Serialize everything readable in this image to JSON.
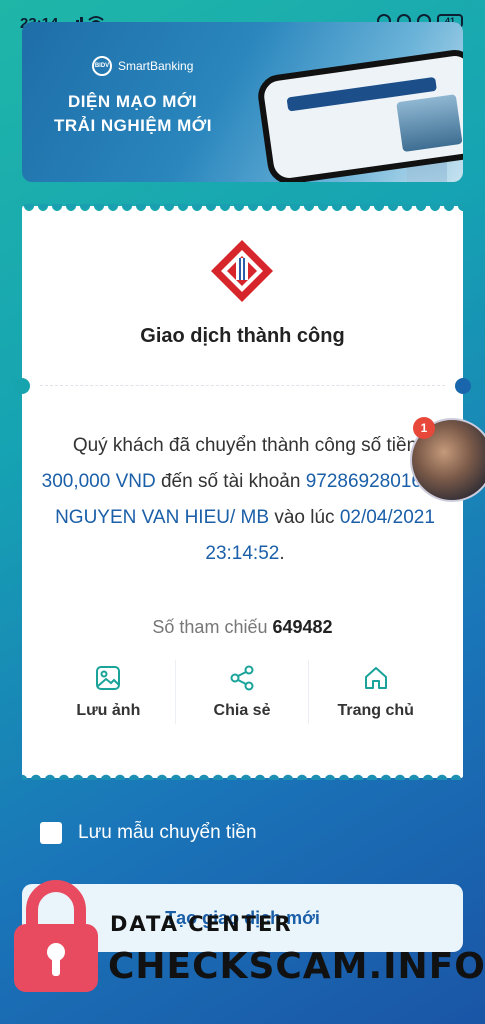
{
  "status_bar": {
    "time": "23:14",
    "battery": "41"
  },
  "banner": {
    "logo_short": "BIDV",
    "logo_text": "SmartBanking",
    "headline_1": "DIỆN MẠO MỚI",
    "headline_2": "TRẢI NGHIỆM MỚI"
  },
  "receipt": {
    "title": "Giao dịch thành công",
    "message_prefix": "Quý khách đã chuyển thành công số tiền",
    "amount": "300,000 VND",
    "message_mid": "đến số tài khoản",
    "account": "9728692801601/ NGUYEN VAN HIEU/ MB",
    "message_time_prefix": "vào lúc",
    "timestamp": "02/04/2021 23:14:52",
    "reference_label": "Số tham chiếu",
    "reference_value": "649482"
  },
  "actions": [
    {
      "label": "Lưu ảnh",
      "icon": "image-icon"
    },
    {
      "label": "Chia sẻ",
      "icon": "share-icon"
    },
    {
      "label": "Trang chủ",
      "icon": "home-icon"
    }
  ],
  "floating_chat": {
    "badge": "1"
  },
  "save_template": {
    "label": "Lưu mẫu chuyển tiền",
    "checked": false
  },
  "new_transaction": {
    "label": "Tạo giao dịch mới"
  },
  "watermark": {
    "line1": "DATA CENTER",
    "line2": "CHECKSCAM.INFO"
  },
  "colors": {
    "accent": "#1b5fa8",
    "bidv_red": "#d7262b",
    "badge": "#e8483a"
  }
}
